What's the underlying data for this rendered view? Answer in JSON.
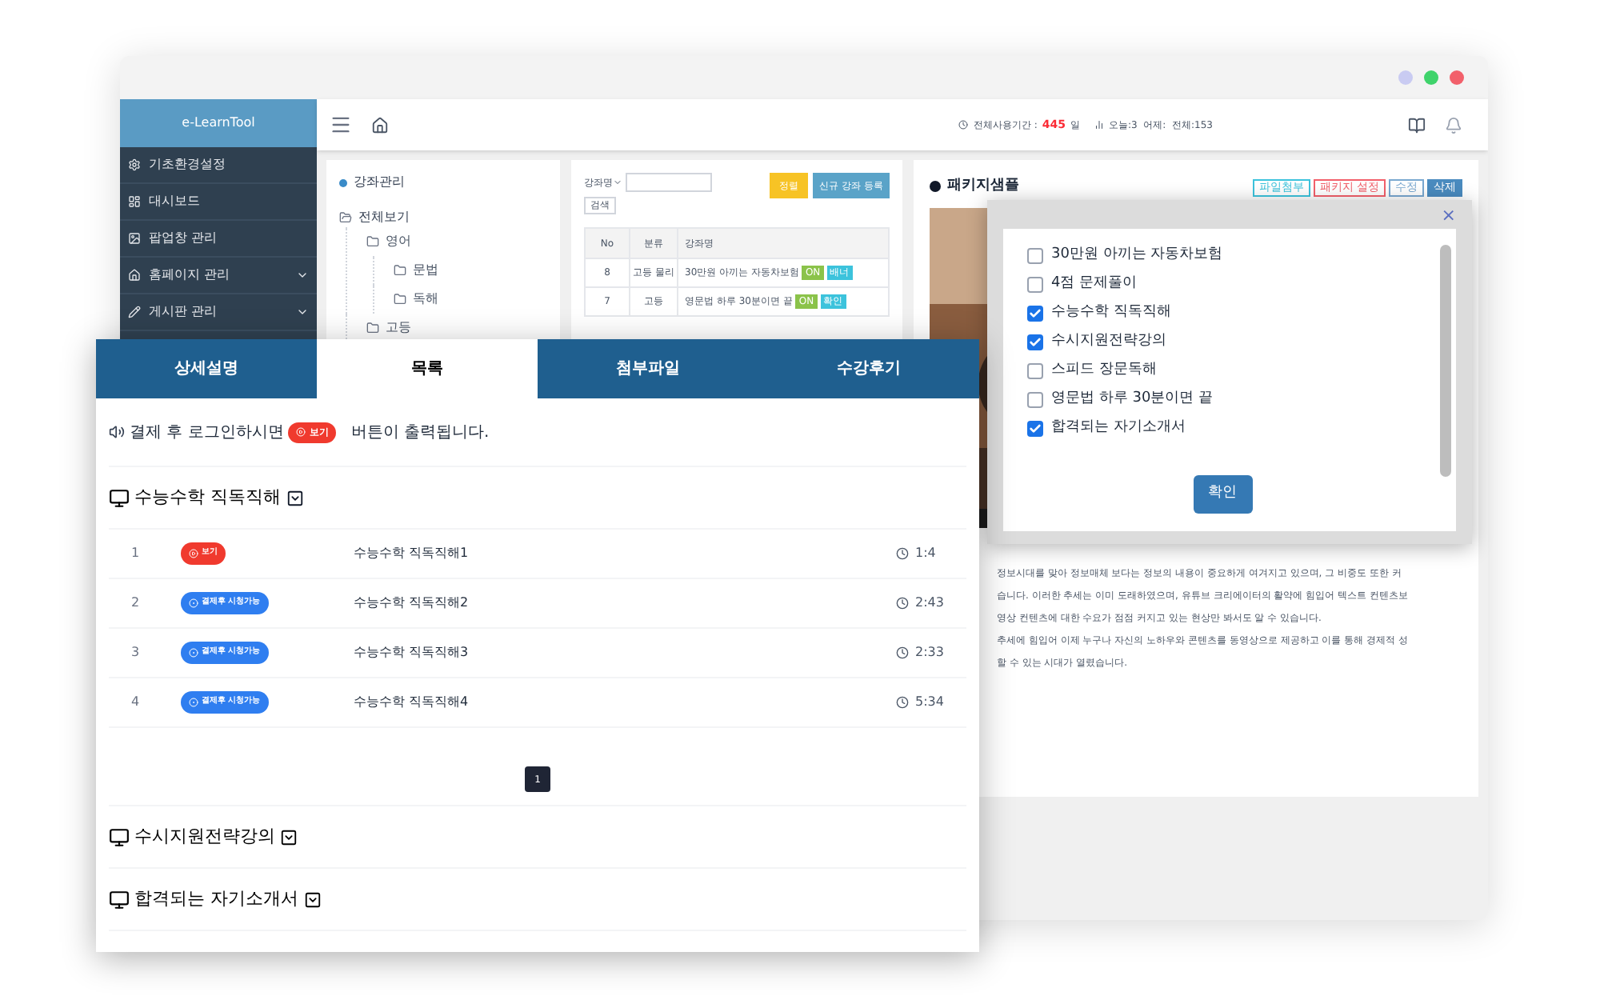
{
  "window": {
    "controls": [
      {
        "color": "#c9cbf2"
      },
      {
        "color": "#3fd36b"
      },
      {
        "color": "#f2606b"
      }
    ]
  },
  "sidebar": {
    "brand": "e-LearnTool",
    "items": [
      {
        "label": "기초환경설정",
        "expandable": false
      },
      {
        "label": "대시보드",
        "expandable": false
      },
      {
        "label": "팝업창 관리",
        "expandable": false
      },
      {
        "label": "홈페이지 관리",
        "expandable": true
      },
      {
        "label": "게시판 관리",
        "expandable": true
      }
    ]
  },
  "topbar": {
    "period_label": "전체사용기간 :",
    "period_value": "445",
    "period_unit": "일",
    "visits": "오늘:3  어제:  전체:153"
  },
  "tree": {
    "title": "강좌관리",
    "root": "전체보기",
    "nodes": [
      {
        "label": "영어",
        "children": [
          {
            "label": "문법"
          },
          {
            "label": "독해"
          }
        ]
      },
      {
        "label": "고등"
      }
    ]
  },
  "course_list": {
    "filter": "강좌명",
    "search_button": "검색",
    "sort_button": "정렬",
    "add_button": "신규 강좌 등록",
    "columns": [
      "No",
      "분류",
      "강좌명"
    ],
    "rows": [
      {
        "no": "8",
        "category": "고등 물리",
        "title": "30만원 아끼는 자동차보험",
        "tags": [
          {
            "text": "ON",
            "color": "#8bc34a"
          },
          {
            "text": "배너",
            "color": "#3cc3dc"
          }
        ]
      },
      {
        "no": "7",
        "category": "고등",
        "title": "영문법 하루 30분이면 끝",
        "tags": [
          {
            "text": "ON",
            "color": "#8bc34a"
          },
          {
            "text": "확인",
            "color": "#3cc3dc"
          }
        ]
      }
    ]
  },
  "package": {
    "title": "패키지샘플",
    "buttons": [
      {
        "label": "파일첨부",
        "color": "#3cc3dc",
        "kind": "outline"
      },
      {
        "label": "패키지 설정",
        "color": "#f2606b",
        "kind": "outline"
      },
      {
        "label": "수정",
        "color": "#7aa8d0",
        "kind": "outline"
      },
      {
        "label": "삭제",
        "color": "#4a8bbf",
        "kind": "solid"
      }
    ],
    "paragraph_lines": [
      "정보시대를 맞아 정보매체 보다는 정보의 내용이 중요하게 여겨지고 있으며, 그 비중도 또한 커",
      "습니다. 이러한 추세는 이미 도래하였으며, 유튜브 크리에이터의 활약에 힘입어 텍스트 컨텐츠보",
      "영상 컨텐츠에 대한 수요가 점점 커지고 있는 현상만 봐서도 알 수 있습니다.",
      "추세에 힘입어 이제 누구나 자신의 노하우와 콘텐츠를 동영상으로 제공하고 이를 통해 경제적 성",
      "할 수 있는 시대가 열렸습니다."
    ]
  },
  "modal": {
    "close": "×",
    "items": [
      {
        "label": "30만원 아끼는 자동차보험",
        "checked": false
      },
      {
        "label": "4점 문제풀이",
        "checked": false
      },
      {
        "label": "수능수학 직독직해",
        "checked": true
      },
      {
        "label": "수시지원전략강의",
        "checked": true
      },
      {
        "label": "스피드 장문독해",
        "checked": false
      },
      {
        "label": "영문법 하루 30분이면 끝",
        "checked": false
      },
      {
        "label": "합격되는 자기소개서",
        "checked": true
      }
    ],
    "confirm": "확인"
  },
  "detail": {
    "tabs": [
      {
        "label": "상세설명",
        "selected": false
      },
      {
        "label": "목록",
        "selected": true
      },
      {
        "label": "첨부파일",
        "selected": false
      },
      {
        "label": "수강후기",
        "selected": false
      }
    ],
    "notice": {
      "before": "결제 후 로그인하시면",
      "badge": "보기",
      "after": "버튼이 출력됩니다."
    },
    "sections": [
      {
        "title": "수능수학 직독직해",
        "expanded": true,
        "lessons": [
          {
            "no": "1",
            "kind": "free",
            "badge": "보기",
            "title": "수능수학 직독직해1",
            "duration": "1:4"
          },
          {
            "no": "2",
            "kind": "locked",
            "badge": "결제후 시청가능",
            "title": "수능수학 직독직해2",
            "duration": "2:43"
          },
          {
            "no": "3",
            "kind": "locked",
            "badge": "결제후 시청가능",
            "title": "수능수학 직독직해3",
            "duration": "2:33"
          },
          {
            "no": "4",
            "kind": "locked",
            "badge": "결제후 시청가능",
            "title": "수능수학 직독직해4",
            "duration": "5:34"
          }
        ],
        "pages": [
          {
            "label": "1",
            "selected": true
          }
        ]
      },
      {
        "title": "수시지원전략강의",
        "expanded": false
      },
      {
        "title": "합격되는 자기소개서",
        "expanded": false
      }
    ]
  }
}
